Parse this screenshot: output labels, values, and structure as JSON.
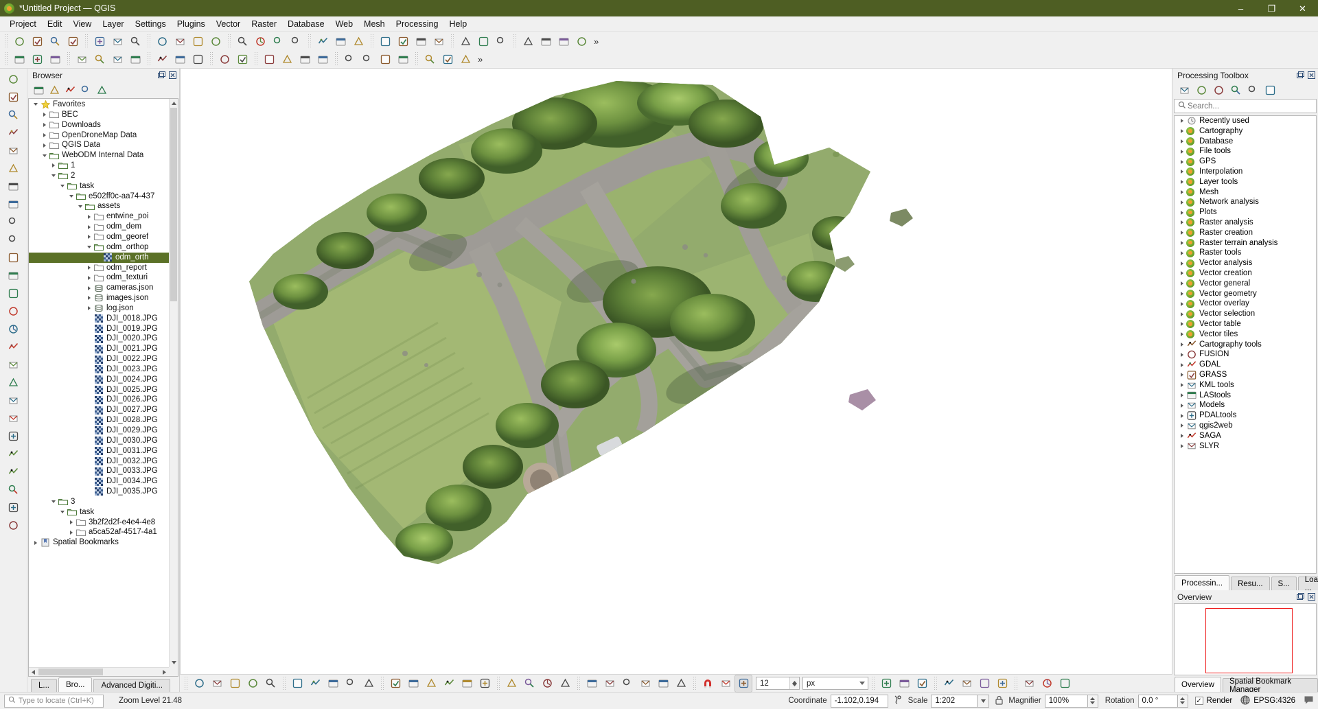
{
  "window": {
    "title": "*Untitled Project — QGIS",
    "logo": "qgis-logo",
    "minimize": "–",
    "maximize": "❐",
    "close": "✕"
  },
  "menubar": {
    "items": [
      "Project",
      "Edit",
      "View",
      "Layer",
      "Settings",
      "Plugins",
      "Vector",
      "Raster",
      "Database",
      "Web",
      "Mesh",
      "Processing",
      "Help"
    ]
  },
  "toolbar": {
    "overflow_label": "»",
    "row1_icons": [
      "new-project-icon",
      "open-project-icon",
      "save-project-icon",
      "save-project-as-icon",
      "new-print-layout-icon",
      "layout-manager-icon",
      "show-layouts-icon",
      "pan-map-icon",
      "pan-to-selection-icon",
      "zoom-in-icon",
      "zoom-out-icon",
      "zoom-full-icon",
      "zoom-to-selection-icon",
      "zoom-to-layer-icon",
      "zoom-native-icon",
      "zoom-last-icon",
      "zoom-next-icon",
      "refresh-icon",
      "identify-features-icon",
      "select-features-icon",
      "deselect-icon",
      "open-attribute-table-icon",
      "measure-line-icon",
      "text-annotation-icon",
      "show-map-tips-icon",
      "new-bookmark-icon",
      "show-bookmarks-icon",
      "new-3d-map-view-icon",
      "statistical-summary-icon"
    ],
    "row2_icons": [
      "current-edits-icon",
      "toggle-editing-icon",
      "save-layer-edits-icon",
      "add-feature-icon",
      "vertex-tool-icon",
      "modify-attributes-icon",
      "delete-selected-icon",
      "cut-features-icon",
      "copy-features-icon",
      "paste-features-icon",
      "undo-icon",
      "redo-icon",
      "data-source-manager-icon",
      "add-vector-layer-icon",
      "add-raster-layer-icon",
      "add-mesh-layer-icon",
      "add-delimited-text-layer-icon",
      "add-postgis-layer-icon",
      "add-spatialite-layer-icon",
      "add-wms-layer-icon",
      "style-manager-icon",
      "python-console-icon",
      "plugin-manager-icon"
    ]
  },
  "left_rail": {
    "icons": [
      "new-project-icon",
      "open-project-icon",
      "save-project-icon",
      "georeferencer-icon",
      "layer-styling-icon",
      "add-vector-layer-icon",
      "add-raster-layer-icon",
      "add-mesh-layer-icon",
      "add-delimited-text-layer-icon",
      "add-postgis-layer-icon",
      "add-spatialite-layer-icon",
      "add-wms-layer-icon",
      "add-wcs-layer-icon",
      "add-wfs-layer-icon",
      "add-vector-tile-icon",
      "new-shapefile-icon",
      "new-geopackage-icon",
      "new-spatialite-icon",
      "new-gpx-icon",
      "new-virtual-layer-icon",
      "add-annotation-layer-icon",
      "open-field-calculator-icon",
      "add-point-cloud-layer-icon",
      "add-xyz-layer-icon",
      "add-arcgis-layer-icon",
      "measure-area-icon"
    ]
  },
  "browser": {
    "panel_title": "Browser",
    "tools": [
      "add-layer-icon",
      "refresh-icon",
      "filter-icon",
      "collapse-all-icon",
      "properties-icon"
    ],
    "tree": [
      {
        "depth": 0,
        "label": "Favorites",
        "icon": "star-icon",
        "twisty": "down",
        "selected": false
      },
      {
        "depth": 1,
        "label": "BEC",
        "icon": "folder-icon",
        "twisty": "right",
        "selected": false
      },
      {
        "depth": 1,
        "label": "Downloads",
        "icon": "folder-icon",
        "twisty": "right",
        "selected": false
      },
      {
        "depth": 1,
        "label": "OpenDroneMap Data",
        "icon": "folder-icon",
        "twisty": "right",
        "selected": false
      },
      {
        "depth": 1,
        "label": "QGIS Data",
        "icon": "folder-icon",
        "twisty": "right",
        "selected": false
      },
      {
        "depth": 1,
        "label": "WebODM Internal Data",
        "icon": "folder-open-icon",
        "twisty": "down",
        "selected": false
      },
      {
        "depth": 2,
        "label": "1",
        "icon": "folder-open-icon",
        "twisty": "right",
        "selected": false
      },
      {
        "depth": 2,
        "label": "2",
        "icon": "folder-open-icon",
        "twisty": "down",
        "selected": false
      },
      {
        "depth": 3,
        "label": "task",
        "icon": "folder-open-icon",
        "twisty": "down",
        "selected": false
      },
      {
        "depth": 4,
        "label": "e502ff0c-aa74-437",
        "icon": "folder-open-icon",
        "twisty": "down",
        "selected": false
      },
      {
        "depth": 5,
        "label": "assets",
        "icon": "folder-open-icon",
        "twisty": "down",
        "selected": false
      },
      {
        "depth": 6,
        "label": "entwine_poi",
        "icon": "folder-icon",
        "twisty": "right",
        "selected": false
      },
      {
        "depth": 6,
        "label": "odm_dem",
        "icon": "folder-icon",
        "twisty": "right",
        "selected": false
      },
      {
        "depth": 6,
        "label": "odm_georef",
        "icon": "folder-icon",
        "twisty": "right",
        "selected": false
      },
      {
        "depth": 6,
        "label": "odm_orthop",
        "icon": "folder-open-icon",
        "twisty": "down",
        "selected": false
      },
      {
        "depth": 7,
        "label": "odm_orth",
        "icon": "raster-icon",
        "twisty": "none",
        "selected": true
      },
      {
        "depth": 6,
        "label": "odm_report",
        "icon": "folder-icon",
        "twisty": "right",
        "selected": false
      },
      {
        "depth": 6,
        "label": "odm_texturi",
        "icon": "folder-icon",
        "twisty": "right",
        "selected": false
      },
      {
        "depth": 6,
        "label": "cameras.json",
        "icon": "database-icon",
        "twisty": "right",
        "selected": false
      },
      {
        "depth": 6,
        "label": "images.json",
        "icon": "database-icon",
        "twisty": "right",
        "selected": false
      },
      {
        "depth": 6,
        "label": "log.json",
        "icon": "database-icon",
        "twisty": "right",
        "selected": false
      },
      {
        "depth": 6,
        "label": "DJI_0018.JPG",
        "icon": "raster-icon",
        "twisty": "none",
        "selected": false
      },
      {
        "depth": 6,
        "label": "DJI_0019.JPG",
        "icon": "raster-icon",
        "twisty": "none",
        "selected": false
      },
      {
        "depth": 6,
        "label": "DJI_0020.JPG",
        "icon": "raster-icon",
        "twisty": "none",
        "selected": false
      },
      {
        "depth": 6,
        "label": "DJI_0021.JPG",
        "icon": "raster-icon",
        "twisty": "none",
        "selected": false
      },
      {
        "depth": 6,
        "label": "DJI_0022.JPG",
        "icon": "raster-icon",
        "twisty": "none",
        "selected": false
      },
      {
        "depth": 6,
        "label": "DJI_0023.JPG",
        "icon": "raster-icon",
        "twisty": "none",
        "selected": false
      },
      {
        "depth": 6,
        "label": "DJI_0024.JPG",
        "icon": "raster-icon",
        "twisty": "none",
        "selected": false
      },
      {
        "depth": 6,
        "label": "DJI_0025.JPG",
        "icon": "raster-icon",
        "twisty": "none",
        "selected": false
      },
      {
        "depth": 6,
        "label": "DJI_0026.JPG",
        "icon": "raster-icon",
        "twisty": "none",
        "selected": false
      },
      {
        "depth": 6,
        "label": "DJI_0027.JPG",
        "icon": "raster-icon",
        "twisty": "none",
        "selected": false
      },
      {
        "depth": 6,
        "label": "DJI_0028.JPG",
        "icon": "raster-icon",
        "twisty": "none",
        "selected": false
      },
      {
        "depth": 6,
        "label": "DJI_0029.JPG",
        "icon": "raster-icon",
        "twisty": "none",
        "selected": false
      },
      {
        "depth": 6,
        "label": "DJI_0030.JPG",
        "icon": "raster-icon",
        "twisty": "none",
        "selected": false
      },
      {
        "depth": 6,
        "label": "DJI_0031.JPG",
        "icon": "raster-icon",
        "twisty": "none",
        "selected": false
      },
      {
        "depth": 6,
        "label": "DJI_0032.JPG",
        "icon": "raster-icon",
        "twisty": "none",
        "selected": false
      },
      {
        "depth": 6,
        "label": "DJI_0033.JPG",
        "icon": "raster-icon",
        "twisty": "none",
        "selected": false
      },
      {
        "depth": 6,
        "label": "DJI_0034.JPG",
        "icon": "raster-icon",
        "twisty": "none",
        "selected": false
      },
      {
        "depth": 6,
        "label": "DJI_0035.JPG",
        "icon": "raster-icon",
        "twisty": "none",
        "selected": false
      },
      {
        "depth": 2,
        "label": "3",
        "icon": "folder-open-icon",
        "twisty": "down",
        "selected": false
      },
      {
        "depth": 3,
        "label": "task",
        "icon": "folder-open-icon",
        "twisty": "down",
        "selected": false
      },
      {
        "depth": 4,
        "label": "3b2f2d2f-e4e4-4e8",
        "icon": "folder-icon",
        "twisty": "right",
        "selected": false
      },
      {
        "depth": 4,
        "label": "a5ca52af-4517-4a1",
        "icon": "folder-icon",
        "twisty": "right",
        "selected": false
      },
      {
        "depth": 0,
        "label": "Spatial Bookmarks",
        "icon": "bookmark-icon",
        "twisty": "right",
        "selected": false
      }
    ],
    "tabs": [
      {
        "label": "L...",
        "active": false
      },
      {
        "label": "Bro...",
        "active": true
      },
      {
        "label": "Advanced Digiti...",
        "active": false
      }
    ]
  },
  "processing": {
    "panel_title": "Processing Toolbox",
    "tools": [
      "models-icon",
      "python-script-icon",
      "history-icon",
      "results-viewer-icon",
      "edit-rendering-icon",
      "options-icon"
    ],
    "search": {
      "placeholder": "Search...",
      "value": "",
      "icon": "search-icon"
    },
    "items": [
      {
        "label": "Recently used",
        "icon": "clock-icon"
      },
      {
        "label": "Cartography",
        "icon": "qgis-icon"
      },
      {
        "label": "Database",
        "icon": "qgis-icon"
      },
      {
        "label": "File tools",
        "icon": "qgis-icon"
      },
      {
        "label": "GPS",
        "icon": "qgis-icon"
      },
      {
        "label": "Interpolation",
        "icon": "qgis-icon"
      },
      {
        "label": "Layer tools",
        "icon": "qgis-icon"
      },
      {
        "label": "Mesh",
        "icon": "qgis-icon"
      },
      {
        "label": "Network analysis",
        "icon": "qgis-icon"
      },
      {
        "label": "Plots",
        "icon": "qgis-icon"
      },
      {
        "label": "Raster analysis",
        "icon": "qgis-icon"
      },
      {
        "label": "Raster creation",
        "icon": "qgis-icon"
      },
      {
        "label": "Raster terrain analysis",
        "icon": "qgis-icon"
      },
      {
        "label": "Raster tools",
        "icon": "qgis-icon"
      },
      {
        "label": "Vector analysis",
        "icon": "qgis-icon"
      },
      {
        "label": "Vector creation",
        "icon": "qgis-icon"
      },
      {
        "label": "Vector general",
        "icon": "qgis-icon"
      },
      {
        "label": "Vector geometry",
        "icon": "qgis-icon"
      },
      {
        "label": "Vector overlay",
        "icon": "qgis-icon"
      },
      {
        "label": "Vector selection",
        "icon": "qgis-icon"
      },
      {
        "label": "Vector table",
        "icon": "qgis-icon"
      },
      {
        "label": "Vector tiles",
        "icon": "qgis-icon"
      },
      {
        "label": "Cartography tools",
        "icon": "cartography-tools-icon"
      },
      {
        "label": "FUSION",
        "icon": "fusion-icon"
      },
      {
        "label": "GDAL",
        "icon": "gdal-icon"
      },
      {
        "label": "GRASS",
        "icon": "grass-icon"
      },
      {
        "label": "KML tools",
        "icon": "kml-icon"
      },
      {
        "label": "LAStools",
        "icon": "lastools-icon"
      },
      {
        "label": "Models",
        "icon": "models-icon"
      },
      {
        "label": "PDALtools",
        "icon": "pdal-icon"
      },
      {
        "label": "qgis2web",
        "icon": "qgis2web-icon"
      },
      {
        "label": "SAGA",
        "icon": "saga-icon"
      },
      {
        "label": "SLYR",
        "icon": "slyr-icon"
      }
    ],
    "tabs": [
      {
        "label": "Processin...",
        "active": true
      },
      {
        "label": "Resu...",
        "active": false
      },
      {
        "label": "S...",
        "active": false
      },
      {
        "label": "Load ...",
        "active": false
      }
    ]
  },
  "overview": {
    "panel_title": "Overview",
    "extent_rect_color": "#ee1c1c",
    "tabs": [
      {
        "label": "Overview",
        "active": true
      },
      {
        "label": "Spatial Bookmark Manager",
        "active": false
      }
    ]
  },
  "bottom_toolbar": {
    "left_icons": [
      "pan-map-icon",
      "pan-to-selection-icon",
      "zoom-in-icon",
      "zoom-out-icon",
      "zoom-full-icon",
      "identify-features-icon",
      "zoom-last-icon",
      "zoom-next-icon",
      "zoom-native-icon",
      "measure-line-icon",
      "select-features-icon",
      "deselect-features-icon",
      "open-table-icon",
      "open-field-calculator-icon",
      "select-by-expression-icon",
      "temporal-controller-icon",
      "refresh-icon",
      "map-tips-icon",
      "snapping-settings-icon",
      "sum-icon",
      "attribute-table-icon",
      "layout-icon",
      "show-map-tips-icon",
      "zoom-selection-icon"
    ],
    "label_icons": [
      "label-toggle-icon",
      "highlight-pinned-labels-icon"
    ],
    "snap_icon": "magnet-icon",
    "topology_icon": "topological-editing-icon",
    "avoid_overlap_icon": "avoid-overlap-icon",
    "tolerance": {
      "value": "12",
      "units": "px"
    },
    "right_icons": [
      "snap-vertex-icon",
      "new-3d-map-view-icon",
      "select-location-icon",
      "move-label-icon",
      "rotate-label-icon",
      "change-label-icon",
      "pin-labels-icon",
      "show-hide-labels-icon",
      "new-annotation-icon",
      "text-annotation-icon"
    ]
  },
  "statusbar": {
    "locator": {
      "placeholder": "Type to locate (Ctrl+K)",
      "icon": "search-icon",
      "value": ""
    },
    "zoom_level_label": "Zoom Level 21.48",
    "coordinate_label": "Coordinate",
    "coordinate_value": "-1.102,0.194",
    "coordinate_toggle_icon": "coordinate-capture-icon",
    "scale_label": "Scale",
    "scale_value": "1:202",
    "lock_icon": "lock-scale-icon",
    "magnifier_label": "Magnifier",
    "magnifier_value": "100%",
    "rotation_label": "Rotation",
    "rotation_value": "0.0 °",
    "render_label": "Render",
    "render_checked": true,
    "crs_label": "EPSG:4326",
    "crs_icon": "globe-icon",
    "messages_icon": "messages-icon"
  }
}
